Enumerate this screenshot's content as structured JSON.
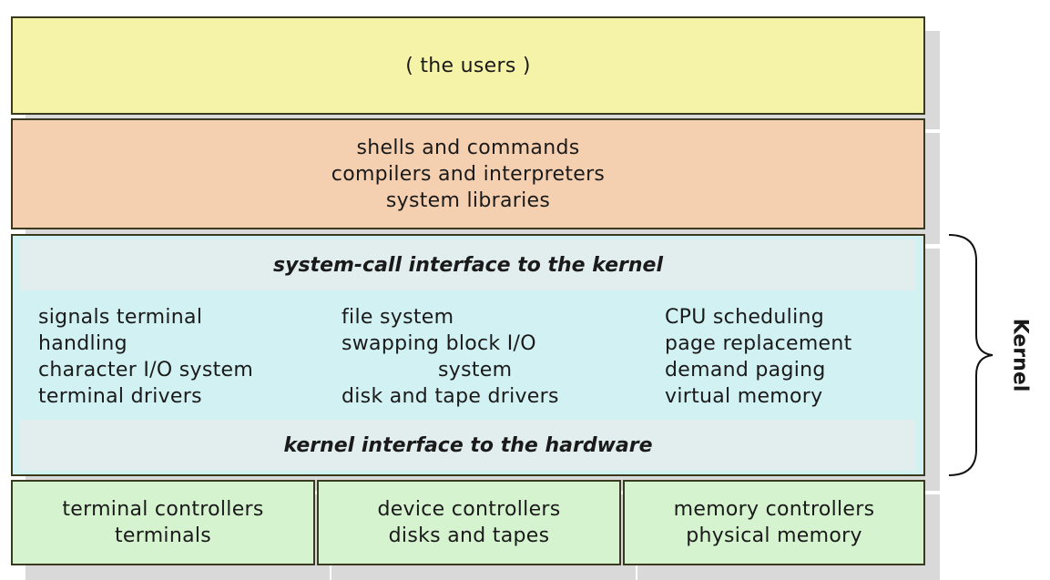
{
  "users": {
    "text": "( the users )"
  },
  "shells": {
    "lines": [
      "shells and commands",
      "compilers and interpreters",
      "system libraries"
    ]
  },
  "kernel": {
    "top_interface": "system-call interface to the kernel",
    "bottom_interface": "kernel interface to the hardware",
    "columns": [
      [
        "signals terminal",
        "handling",
        "character I/O system",
        "terminal drivers"
      ],
      [
        "file system",
        "swapping block I/O",
        "system",
        "disk and tape drivers"
      ],
      [
        "CPU scheduling",
        "page replacement",
        "demand paging",
        "virtual memory"
      ]
    ],
    "label": "Kernel"
  },
  "hardware": [
    {
      "lines": [
        "terminal controllers",
        "terminals"
      ]
    },
    {
      "lines": [
        "device controllers",
        "disks and tapes"
      ]
    },
    {
      "lines": [
        "memory controllers",
        "physical memory"
      ]
    }
  ]
}
